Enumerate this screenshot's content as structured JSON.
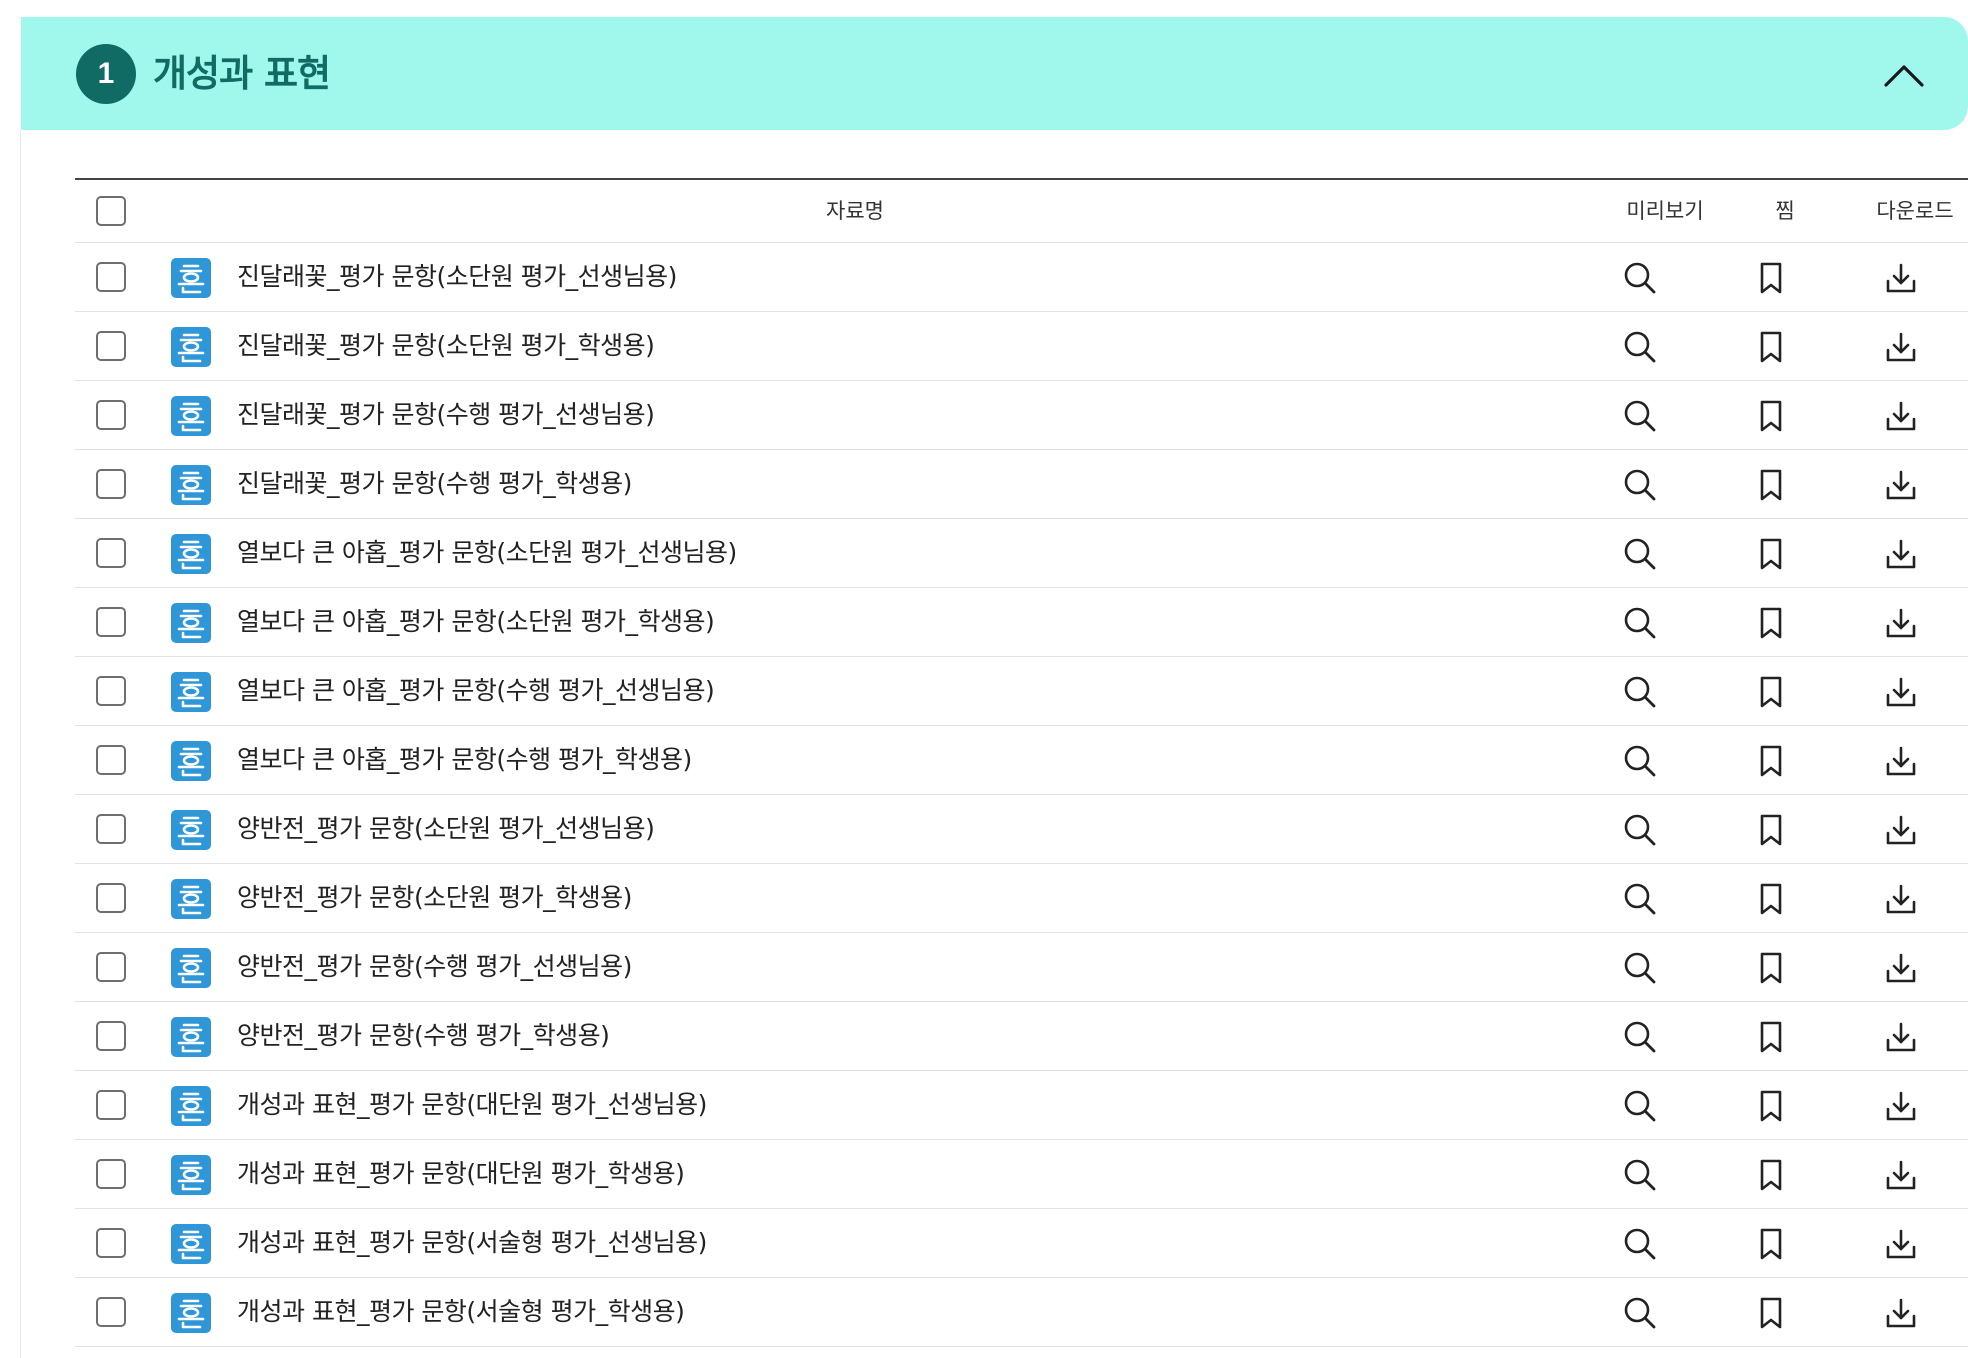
{
  "section": {
    "number": "1",
    "title": "개성과 표현",
    "toggle_icon": "chevron-up-icon"
  },
  "table": {
    "headers": {
      "name": "자료명",
      "preview": "미리보기",
      "bookmark": "찜",
      "download": "다운로드"
    },
    "file_icon": "hwp-file-icon",
    "action_icons": [
      "search-icon",
      "bookmark-icon",
      "download-icon"
    ],
    "rows": [
      {
        "name": "진달래꽃_평가 문항(소단원 평가_선생님용)"
      },
      {
        "name": "진달래꽃_평가 문항(소단원 평가_학생용)"
      },
      {
        "name": "진달래꽃_평가 문항(수행 평가_선생님용)"
      },
      {
        "name": "진달래꽃_평가 문항(수행 평가_학생용)"
      },
      {
        "name": "열보다 큰 아홉_평가 문항(소단원 평가_선생님용)"
      },
      {
        "name": "열보다 큰 아홉_평가 문항(소단원 평가_학생용)"
      },
      {
        "name": "열보다 큰 아홉_평가 문항(수행 평가_선생님용)"
      },
      {
        "name": "열보다 큰 아홉_평가 문항(수행 평가_학생용)"
      },
      {
        "name": "양반전_평가 문항(소단원 평가_선생님용)"
      },
      {
        "name": "양반전_평가 문항(소단원 평가_학생용)"
      },
      {
        "name": "양반전_평가 문항(수행 평가_선생님용)"
      },
      {
        "name": "양반전_평가 문항(수행 평가_학생용)"
      },
      {
        "name": "개성과 표현_평가 문항(대단원 평가_선생님용)"
      },
      {
        "name": "개성과 표현_평가 문항(대단원 평가_학생용)"
      },
      {
        "name": "개성과 표현_평가 문항(서술형 평가_선생님용)"
      },
      {
        "name": "개성과 표현_평가 문항(서술형 평가_학생용)"
      }
    ]
  },
  "colors": {
    "header_bg": "#a0f7ec",
    "accent": "#0f6b63",
    "file_icon_bg": "#2f97d8"
  }
}
